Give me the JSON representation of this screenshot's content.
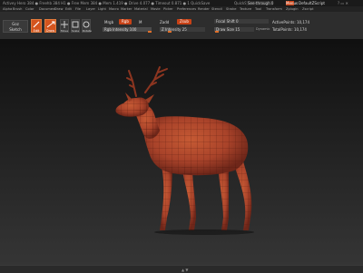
{
  "titlebar": {
    "title": "Activey Hero 384 ● Freehb 384 H1 ● Free Mem 384 ● Mem 1.419 ● Drive 4.077 ● Timeout 0.871 ● 1 QuickSave",
    "quicksave": "QuickSave",
    "see_through": "See-through 0",
    "menus": "Menus",
    "default_zscript": "DefaultZScript",
    "window_controls": "? ▭ ✕"
  },
  "menubar": {
    "items": [
      "Alpha",
      "Brush",
      "Color",
      "Document",
      "Draw",
      "Edit",
      "File",
      "Layer",
      "Light",
      "Macro",
      "Marker",
      "Material",
      "Movie",
      "Picker",
      "Preferences",
      "Render",
      "Stencil",
      "Stroke",
      "Texture",
      "Tool",
      "Transform",
      "Zplugin",
      "Zscript"
    ]
  },
  "toolbar": {
    "gozbrush_label": "Goz\nSketch",
    "edit_label": "Edit",
    "draw_label": "Draw",
    "move_label": "Move",
    "scale_label": "Scale",
    "rotate_label": "Rotate",
    "mrgb": "Mrgb",
    "rgb": "Rgb",
    "m": "M",
    "rgb_intensity_label": "Rgb Intensity 100",
    "zadd": "Zadd",
    "zsub": "Zsub",
    "zintensity_label": "Z Intensity 25",
    "focal_shift_label": "Focal Shift 0",
    "draw_size_label": "Draw Size 15",
    "dynamic": "Dynamic",
    "active_points": "ActivePoints: 10,174",
    "total_points": "TotalPoints: 10,174",
    "rgb_intensity_level": 1.0,
    "zintensity_level": 0.25,
    "draw_size_level": 0.12
  },
  "bottombar": {
    "handle": "▲ ▼"
  },
  "colors": {
    "accent": "#d4541e",
    "model": "#b24a2b"
  }
}
